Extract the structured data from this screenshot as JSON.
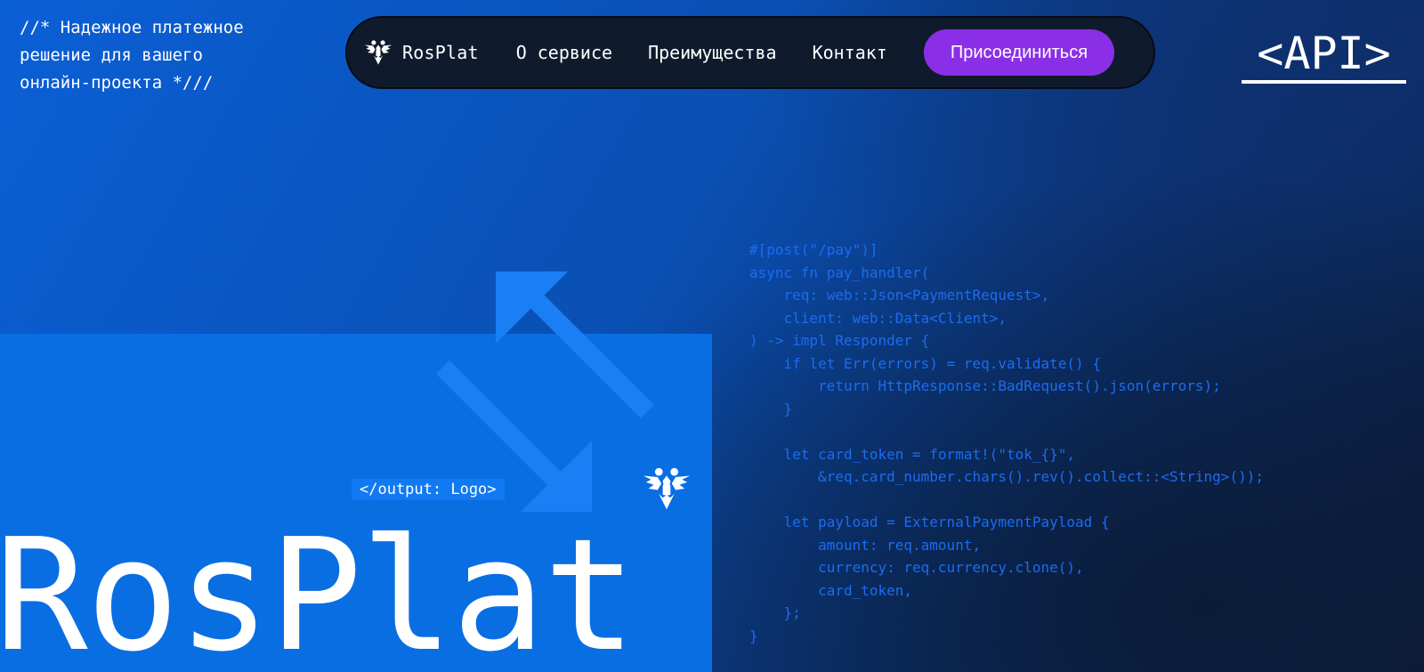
{
  "tagline": {
    "lines": [
      "//* Надежное платежное",
      "решение для вашего",
      "онлайн-проекта */"
    ],
    "last_line": "онлайн-проекта */"
  },
  "navbar": {
    "logo_icon": "double-headed-eagle-icon",
    "brand": "RosPlat",
    "links": [
      "О сервисе",
      "Преимущества",
      "Контакт"
    ],
    "join_label": "Присоединиться"
  },
  "api_link": "<API>",
  "hero": {
    "output_tag": "</output: Logo>",
    "title": "RosPlat",
    "emblem_icon": "double-headed-eagle-icon",
    "arrows_icon": "exchange-arrows-icon"
  },
  "code": {
    "lines": [
      "#[post(\"/pay\")]",
      "async fn pay_handler(",
      "    req: web::Json<PaymentRequest>,",
      "    client: web::Data<Client>,",
      ") -> impl Responder {",
      "    if let Err(errors) = req.validate() {",
      "        return HttpResponse::BadRequest().json(errors);",
      "    }",
      "",
      "    let card_token = format!(\"tok_{}\",",
      "        &req.card_number.chars().rev().collect::<String>());",
      "",
      "    let payload = ExternalPaymentPayload {",
      "        amount: req.amount,",
      "        currency: req.currency.clone(),",
      "        card_token,",
      "    };",
      "}"
    ]
  },
  "colors": {
    "hero_blue": "#0a6ee3",
    "navbar_bg": "#0f1b2d",
    "join_button": "#8b2fe6",
    "code_text": "#1b6cf0",
    "arrow": "#1a7ff5"
  }
}
